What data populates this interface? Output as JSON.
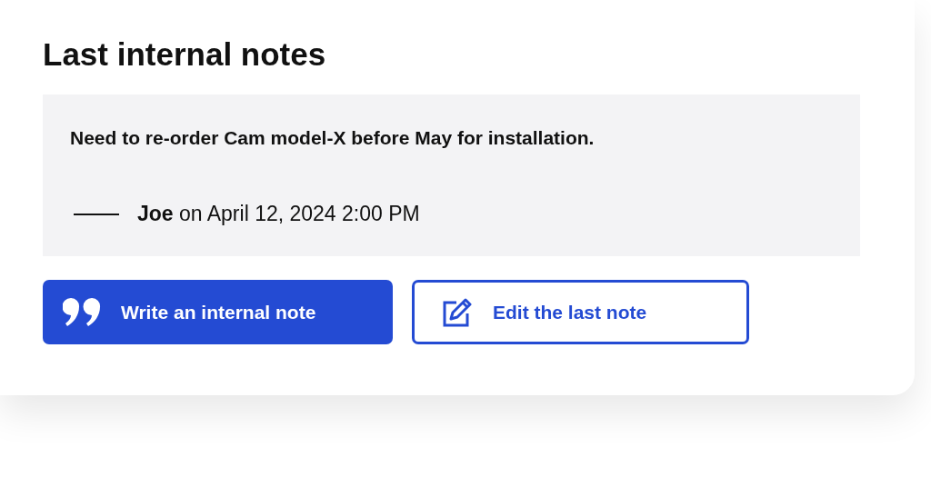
{
  "card": {
    "title": "Last internal notes",
    "note": {
      "text": "Need to re-order Cam model-X before May for installation.",
      "attribution": "**Joe** on April 12, 2024 2:00 PM"
    },
    "buttons": [
      {
        "kind": "primary",
        "label": "Write an internal note"
      },
      {
        "kind": "outline",
        "label": "Edit the last note"
      }
    ]
  }
}
